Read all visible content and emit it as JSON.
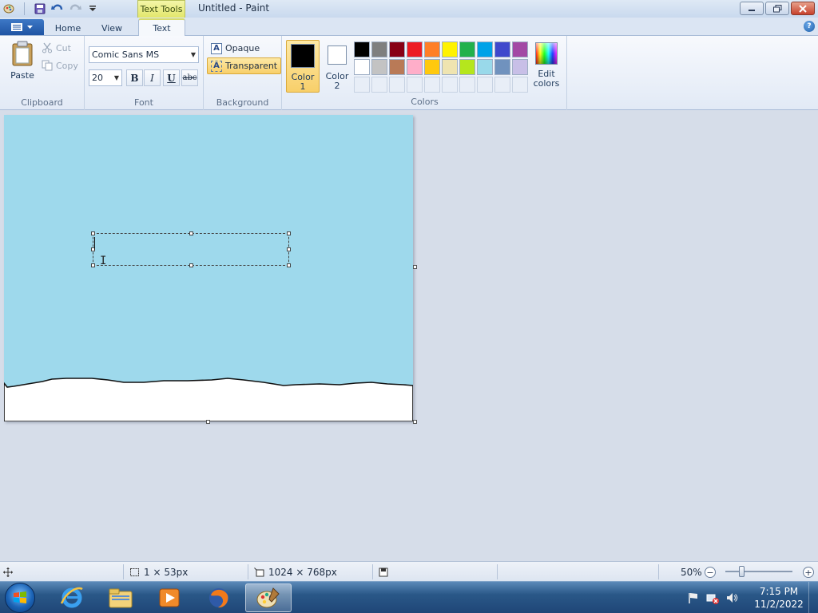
{
  "window": {
    "title": "Untitled - Paint",
    "context_tab_group": "Text Tools"
  },
  "tabs": [
    {
      "label": "Home"
    },
    {
      "label": "View"
    },
    {
      "label": "Text"
    }
  ],
  "ribbon": {
    "clipboard": {
      "label": "Clipboard",
      "paste": "Paste",
      "cut": "Cut",
      "copy": "Copy"
    },
    "font": {
      "label": "Font",
      "family": "Comic Sans MS",
      "size": "20",
      "bold": "B",
      "italic": "I",
      "underline": "U",
      "strikethrough": "abc"
    },
    "background": {
      "label": "Background",
      "opaque": "Opaque",
      "transparent": "Transparent",
      "selected": "Transparent"
    },
    "colors": {
      "label": "Colors",
      "color1_label": "Color 1",
      "color2_label": "Color 2",
      "color1": "#000000",
      "color2": "#ffffff",
      "edit_colors": "Edit colors",
      "palette": [
        "#000000",
        "#7f7f7f",
        "#880015",
        "#ed1c24",
        "#ff7f27",
        "#fff200",
        "#22b14c",
        "#00a2e8",
        "#3f48cc",
        "#a349a4",
        "#ffffff",
        "#c3c3c3",
        "#b97a57",
        "#ffaec9",
        "#ffc90e",
        "#efe4b0",
        "#b5e61d",
        "#99d9ea",
        "#7092be",
        "#c8bfe7"
      ]
    }
  },
  "canvas": {
    "sky_color": "#9ed9ec",
    "ground_color": "#ffffff"
  },
  "statusbar": {
    "selection_size": "1 × 53px",
    "image_size": "1024 × 768px",
    "zoom": "50%"
  },
  "taskbar": {
    "time": "7:15 PM",
    "date": "11/2/2022",
    "pinned": [
      "internet-explorer-icon",
      "file-explorer-icon",
      "media-player-icon",
      "firefox-icon",
      "paint-icon"
    ]
  }
}
